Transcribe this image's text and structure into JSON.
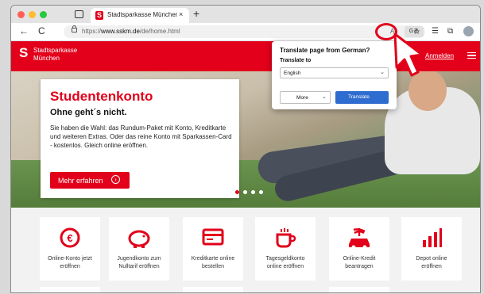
{
  "browser": {
    "tab_title": "Stadtsparkasse München | Die",
    "tab_favicon": "S",
    "tab_close": "×",
    "new_tab": "+",
    "url_prefix": "https://",
    "url_host": "www.sskm.de",
    "url_path": "/de/home.html",
    "reader_label": "Aᵃ",
    "translate_icon_label": "Gあ",
    "back": "←",
    "reload": "C"
  },
  "site": {
    "logo_glyph": "S",
    "logo_line1": "Stadtsparkasse",
    "logo_line2": "München",
    "login_label": "Anmelden"
  },
  "hero": {
    "title": "Studentenkonto",
    "subtitle": "Ohne geht´s nicht.",
    "body": "Sie haben die Wahl: das Rundum-Paket mit Konto, Kreditkarte und weiteren Extras. Oder das reine Konto mit Sparkassen-Card - kostenlos. Gleich online eröffnen.",
    "cta_label": "Mehr erfahren",
    "cta_arrow": "›"
  },
  "translate_popup": {
    "title": "Translate page from German?",
    "translate_to_label": "Translate to",
    "selected_language": "English",
    "more_label": "More",
    "translate_label": "Translate",
    "chevron": "⌄"
  },
  "tiles": [
    {
      "icon": "euro-coin-icon",
      "glyph": "€",
      "line1": "Online-Konto jetzt",
      "line2": "eröffnen"
    },
    {
      "icon": "piggy-bank-icon",
      "glyph": "🐖",
      "line1": "Jugendkonto zum",
      "line2": "Nulltarif eröffnen"
    },
    {
      "icon": "credit-card-icon",
      "glyph": "▭",
      "line1": "Kreditkarte online",
      "line2": "bestellen"
    },
    {
      "icon": "cup-icon",
      "glyph": "☕",
      "line1": "Tagesgeldkonto",
      "line2": "online eröffnen"
    },
    {
      "icon": "car-palm-icon",
      "glyph": "🚗",
      "line1": "Online-Kredit",
      "line2": "beantragen"
    },
    {
      "icon": "bar-chart-icon",
      "glyph": "▮",
      "line1": "Depot online",
      "line2": "eröffnen"
    }
  ],
  "colors": {
    "brand": "#e2001a",
    "translate_button": "#2f6ccf"
  }
}
